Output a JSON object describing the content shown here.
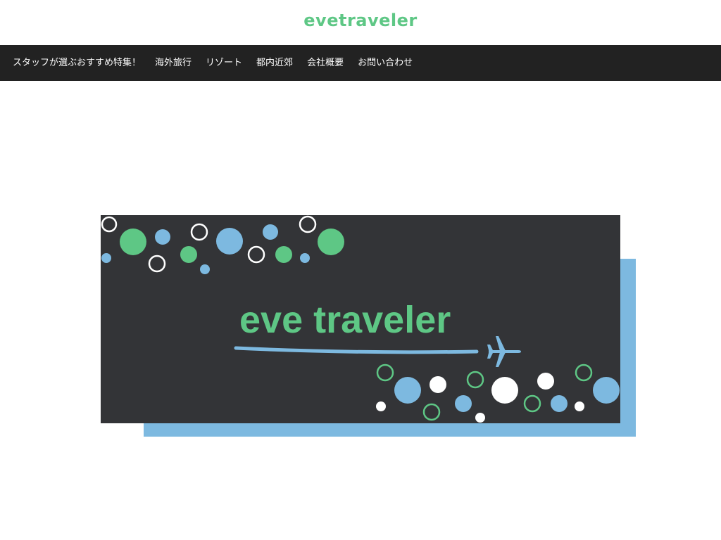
{
  "site": {
    "title": "evetraveler"
  },
  "nav": {
    "items": [
      {
        "label": "スタッフが選ぶおすすめ特集！"
      },
      {
        "label": "海外旅行"
      },
      {
        "label": "リゾート"
      },
      {
        "label": "都内近郊"
      },
      {
        "label": "会社概要"
      },
      {
        "label": "お問い合わせ"
      }
    ]
  },
  "banner": {
    "logo_text": "eve traveler",
    "colors": {
      "background": "#333437",
      "shadow": "#7db9e0",
      "green": "#5ec785",
      "blue": "#7db9e0",
      "white": "#ffffff"
    },
    "icon": "airplane-icon"
  }
}
